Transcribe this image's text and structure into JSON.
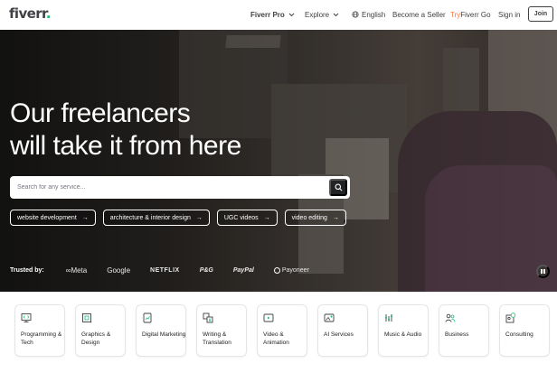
{
  "header": {
    "logo_text": "fiverr",
    "logo_dot": ".",
    "nav": {
      "fiverr_pro": "Fiverr Pro",
      "explore": "Explore",
      "language": "English",
      "become_seller": "Become a Seller",
      "try_part1": "Try ",
      "try_part2": "Fiverr Go",
      "sign_in": "Sign in",
      "join": "Join"
    },
    "icons": {
      "chevron": "chevron-down-icon",
      "globe": "globe-icon"
    }
  },
  "hero": {
    "title_line1": "Our freelancers",
    "title_line2": "will take it from here",
    "search_placeholder": "Search for any service...",
    "chips": [
      {
        "label": "website development"
      },
      {
        "label": "architecture & interior design"
      },
      {
        "label": "UGC videos"
      },
      {
        "label": "video editing"
      }
    ],
    "chip_arrow": "→",
    "trusted_label": "Trusted by:",
    "brands": {
      "meta": "Meta",
      "google": "Google",
      "netflix": "NETFLIX",
      "pg": "P&G",
      "paypal": "PayPal",
      "payoneer": "Payoneer"
    }
  },
  "categories": [
    {
      "label": "Programming & Tech",
      "icon": "monitor-icon"
    },
    {
      "label": "Graphics & Design",
      "icon": "pen-tool-icon"
    },
    {
      "label": "Digital Marketing",
      "icon": "chart-icon"
    },
    {
      "label": "Writing & Translation",
      "icon": "translation-icon"
    },
    {
      "label": "Video & Animation",
      "icon": "video-icon"
    },
    {
      "label": "AI Services",
      "icon": "ai-icon"
    },
    {
      "label": "Music & Audio",
      "icon": "music-icon"
    },
    {
      "label": "Business",
      "icon": "people-icon"
    },
    {
      "label": "Consulting",
      "icon": "consulting-icon"
    }
  ],
  "colors": {
    "brand_green": "#1dbf73",
    "try_orange": "#ff7640",
    "text_dark": "#404145"
  }
}
